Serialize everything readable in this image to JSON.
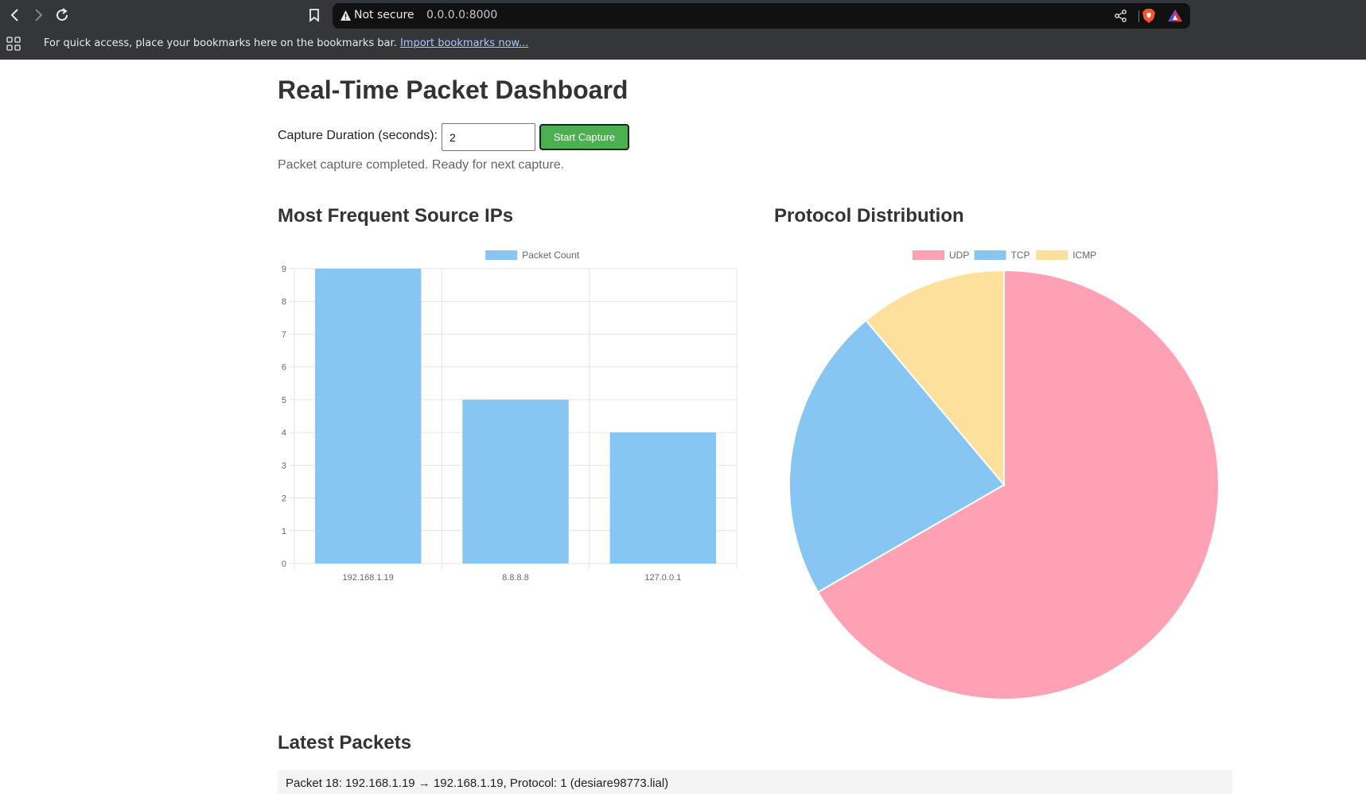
{
  "browser": {
    "security_label": "Not secure",
    "url": "0.0.0.0:8000",
    "bookmarks_bar_text": "For quick access, place your bookmarks here on the bookmarks bar.",
    "bookmarks_import_link": "Import bookmarks now...",
    "icons": [
      "back-icon",
      "forward-icon",
      "reload-icon",
      "bookmark-icon",
      "warning-icon",
      "share-icon",
      "brave-shields-icon",
      "brave-rewards-icon",
      "apps-icon"
    ]
  },
  "page": {
    "title": "Real-Time Packet Dashboard",
    "capture_label": "Capture Duration (seconds):",
    "duration_value": "2",
    "start_button_label": "Start Capture",
    "start_button_color": "#4caf50",
    "status_message": "Packet capture completed. Ready for next capture."
  },
  "bar_section": {
    "title": "Most Frequent Source IPs"
  },
  "pie_section": {
    "title": "Protocol Distribution"
  },
  "chart_data": [
    {
      "type": "bar",
      "categories": [
        "192.168.1.19",
        "8.8.8.8",
        "127.0.0.1"
      ],
      "series": [
        {
          "name": "Packet Count",
          "values": [
            9,
            5,
            4
          ],
          "color": "#87c6f2"
        }
      ],
      "ylim": [
        0,
        9
      ],
      "yticks": [
        0,
        1,
        2,
        3,
        4,
        5,
        6,
        7,
        8,
        9
      ],
      "grid": true,
      "legend": "top-center"
    },
    {
      "type": "pie",
      "labels": [
        "UDP",
        "TCP",
        "ICMP"
      ],
      "values": [
        12,
        4,
        2
      ],
      "colors": [
        "#ffa1b4",
        "#87c6f2",
        "#fde09c"
      ],
      "legend": "top-center"
    }
  ],
  "latest_packets": {
    "title": "Latest Packets",
    "items": [
      "Packet 18: 192.168.1.19 → 192.168.1.19, Protocol: 1 (desiare98773.lial)"
    ]
  }
}
